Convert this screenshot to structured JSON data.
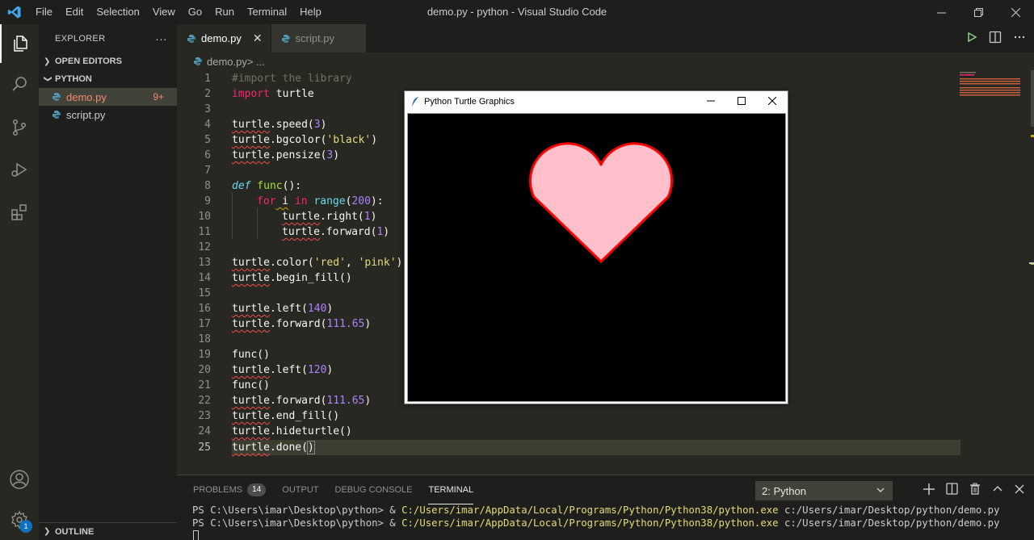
{
  "titlebar": {
    "menu": [
      "File",
      "Edit",
      "Selection",
      "View",
      "Go",
      "Run",
      "Terminal",
      "Help"
    ],
    "title": "demo.py - python - Visual Studio Code"
  },
  "activity": {
    "settings_badge": "1"
  },
  "sidebar": {
    "header": "EXPLORER",
    "more": "···",
    "open_editors": "OPEN EDITORS",
    "folder": "PYTHON",
    "files": [
      {
        "name": "demo.py",
        "count": "9+"
      },
      {
        "name": "script.py"
      }
    ],
    "outline": "OUTLINE"
  },
  "tabs": [
    {
      "label": "demo.py",
      "close": "✕"
    },
    {
      "label": "script.py"
    }
  ],
  "breadcrumb": {
    "file": "demo.py",
    "sep": " > ..."
  },
  "editor": {
    "line_numbers": [
      "1",
      "2",
      "3",
      "4",
      "5",
      "6",
      "7",
      "8",
      "9",
      "10",
      "11",
      "12",
      "13",
      "14",
      "15",
      "16",
      "17",
      "18",
      "19",
      "20",
      "21",
      "22",
      "23",
      "24",
      "25"
    ],
    "code": {
      "l1": "#import the library",
      "l2_kw": "import",
      "l2_mod": " turtle",
      "l4_obj": "turtle",
      "l4_fn": ".speed(",
      "l4_num": "3",
      "l4_end": ")",
      "l5_obj": "turtle",
      "l5_fn": ".bgcolor(",
      "l5_str": "'black'",
      "l5_end": ")",
      "l6_obj": "turtle",
      "l6_fn": ".pensize(",
      "l6_num": "3",
      "l6_end": ")",
      "l8_def": "def",
      "l8_name": " func",
      "l8_end": "():",
      "l9_for": "for",
      "l9_i": " i",
      "l9_in": " in",
      "l9_range": " range",
      "l9_open": "(",
      "l9_num": "200",
      "l9_end": "):",
      "l10_obj": "turtle",
      "l10_fn": ".right(",
      "l10_num": "1",
      "l10_end": ")",
      "l11_obj": "turtle",
      "l11_fn": ".forward(",
      "l11_num": "1",
      "l11_end": ")",
      "l13_obj": "turtle",
      "l13_fn": ".color(",
      "l13_s1": "'red'",
      "l13_c": ", ",
      "l13_s2": "'pink'",
      "l13_end": ")",
      "l14_obj": "turtle",
      "l14_fn": ".begin_fill()",
      "l16_obj": "turtle",
      "l16_fn": ".left(",
      "l16_num": "140",
      "l16_end": ")",
      "l17_obj": "turtle",
      "l17_fn": ".forward(",
      "l17_num": "111.65",
      "l17_end": ")",
      "l19": "func()",
      "l20_obj": "turtle",
      "l20_fn": ".left(",
      "l20_num": "120",
      "l20_end": ")",
      "l21": "func()",
      "l22_obj": "turtle",
      "l22_fn": ".forward(",
      "l22_num": "111.65",
      "l22_end": ")",
      "l23_obj": "turtle",
      "l23_fn": ".end_fill()",
      "l24_obj": "turtle",
      "l24_fn": ".hideturtle()",
      "l25_obj": "turtle",
      "l25_fn": ".done(",
      "l25_end": ")"
    }
  },
  "turtle_window": {
    "title": "Python Turtle Graphics",
    "canvas_bg": "#000000",
    "heart_fill": "#ffc0cb",
    "heart_stroke": "#ff0000"
  },
  "panel": {
    "tabs": [
      "PROBLEMS",
      "OUTPUT",
      "DEBUG CONSOLE",
      "TERMINAL"
    ],
    "problems_count": "14",
    "terminal_select": "2: Python",
    "terminal_lines": [
      {
        "prompt": "PS C:\\Users\\imar\\Desktop\\python> & ",
        "exe": "C:/Users/imar/AppData/Local/Programs/Python/Python38/python.exe",
        "arg": " c:/Users/imar/Desktop/python/demo.py"
      },
      {
        "prompt": "PS C:\\Users\\imar\\Desktop\\python> & ",
        "exe": "C:/Users/imar/AppData/Local/Programs/Python/Python38/python.exe",
        "arg": " c:/Users/imar/Desktop/python/demo.py"
      }
    ]
  }
}
